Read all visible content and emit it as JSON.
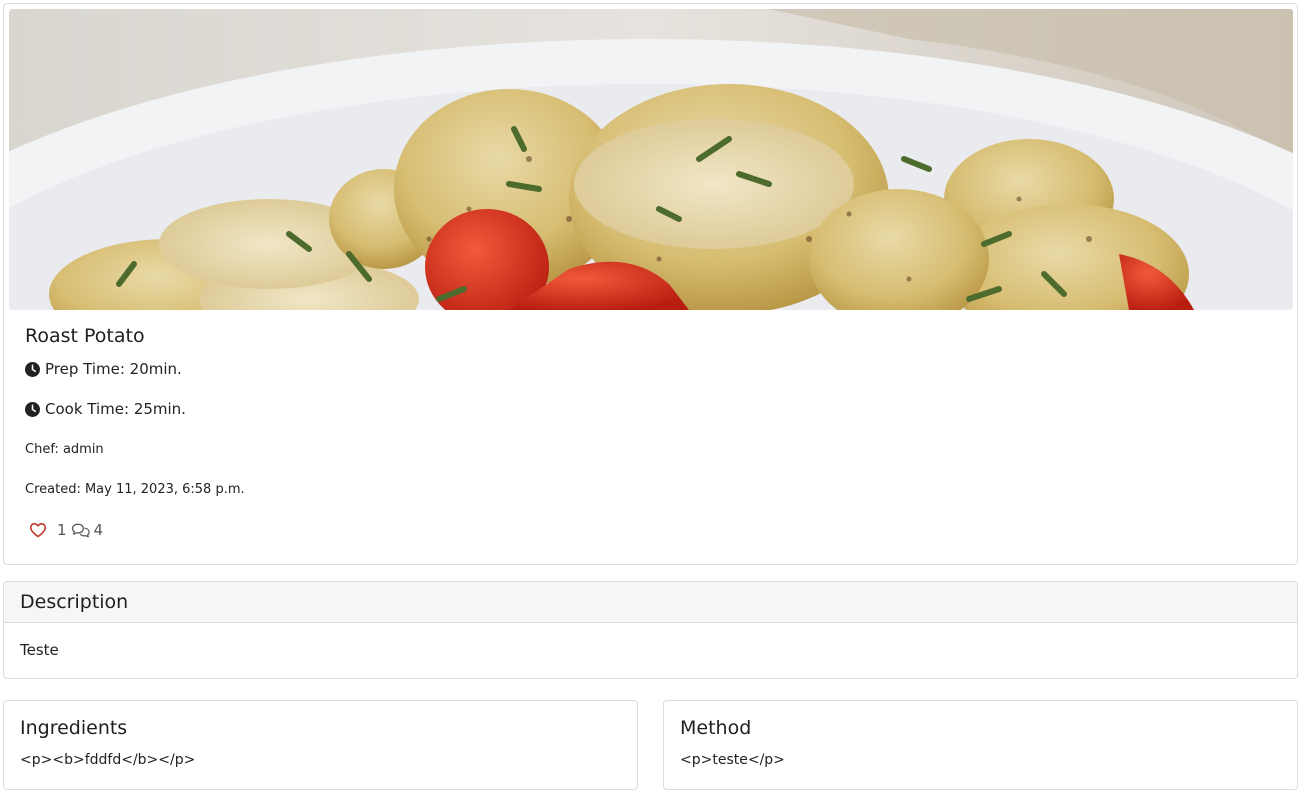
{
  "recipe": {
    "title": "Roast Potato",
    "prep_time": "Prep Time: 20min.",
    "cook_time": "Cook Time: 25min.",
    "chef": "Chef: admin",
    "created": "Created: May 11, 2023, 6:58 p.m.",
    "likes": "1",
    "comments": "4",
    "image_alt": "Roast potatoes with tomatoes and herbs in a white bowl"
  },
  "description": {
    "header": "Description",
    "body": "Teste"
  },
  "ingredients": {
    "header": "Ingredients",
    "body": "<p><b>fddfd</b></p>"
  },
  "method": {
    "header": "Method",
    "body": "<p>teste</p>"
  },
  "icons": {
    "time": "clock-icon",
    "like": "heart-icon",
    "comment": "comment-icon"
  },
  "colors": {
    "like": "#c0392b",
    "border": "#dcdcdc",
    "header_bg": "#f6f6f6"
  }
}
